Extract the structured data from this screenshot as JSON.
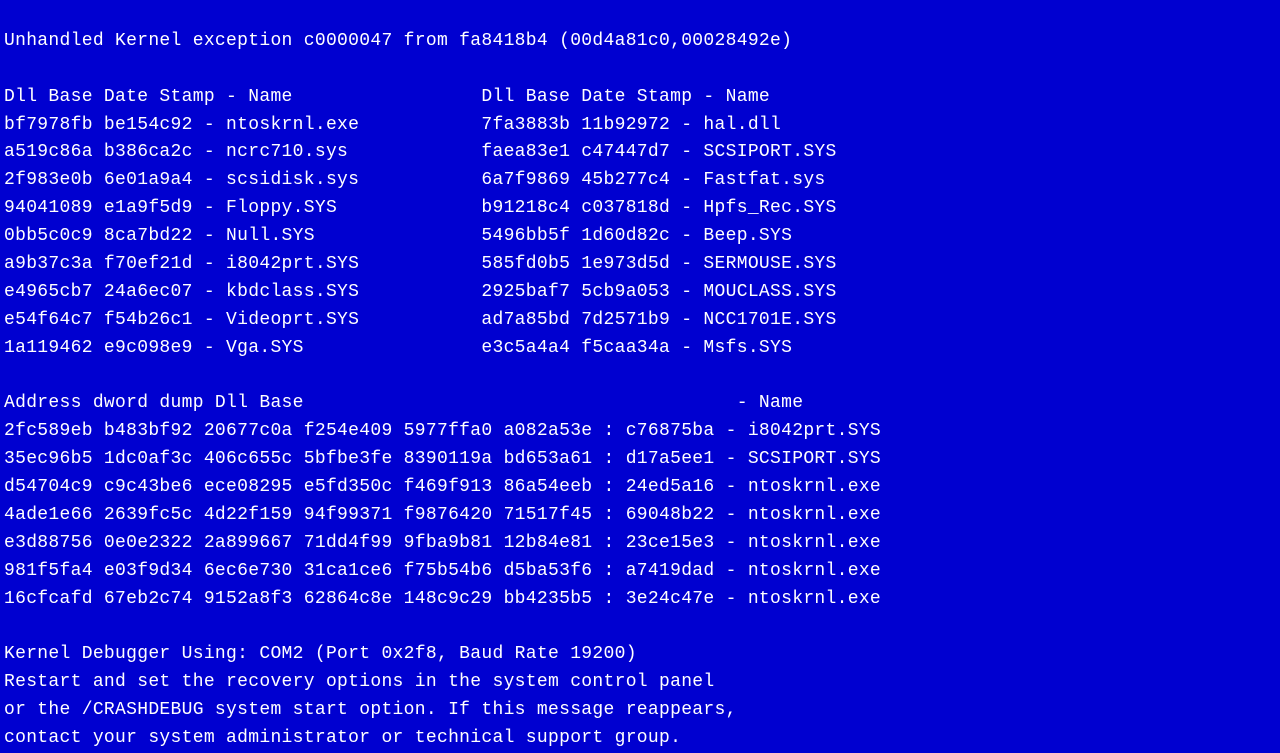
{
  "header_line": "Unhandled Kernel exception c0000047 from fa8418b4 (00d4a81c0,00028492e)",
  "dll_header_left": "Dll Base Date Stamp - Name",
  "dll_header_right": "Dll Base Date Stamp - Name",
  "modules": [
    {
      "lbase": "bf7978fb",
      "lstamp": "be154c92",
      "lname": "ntoskrnl.exe",
      "rbase": "7fa3883b",
      "rstamp": "11b92972",
      "rname": "hal.dll"
    },
    {
      "lbase": "a519c86a",
      "lstamp": "b386ca2c",
      "lname": "ncrc710.sys",
      "rbase": "faea83e1",
      "rstamp": "c47447d7",
      "rname": "SCSIPORT.SYS"
    },
    {
      "lbase": "2f983e0b",
      "lstamp": "6e01a9a4",
      "lname": "scsidisk.sys",
      "rbase": "6a7f9869",
      "rstamp": "45b277c4",
      "rname": "Fastfat.sys"
    },
    {
      "lbase": "94041089",
      "lstamp": "e1a9f5d9",
      "lname": "Floppy.SYS",
      "rbase": "b91218c4",
      "rstamp": "c037818d",
      "rname": "Hpfs_Rec.SYS"
    },
    {
      "lbase": "0bb5c0c9",
      "lstamp": "8ca7bd22",
      "lname": "Null.SYS",
      "rbase": "5496bb5f",
      "rstamp": "1d60d82c",
      "rname": "Beep.SYS"
    },
    {
      "lbase": "a9b37c3a",
      "lstamp": "f70ef21d",
      "lname": "i8042prt.SYS",
      "rbase": "585fd0b5",
      "rstamp": "1e973d5d",
      "rname": "SERMOUSE.SYS"
    },
    {
      "lbase": "e4965cb7",
      "lstamp": "24a6ec07",
      "lname": "kbdclass.SYS",
      "rbase": "2925baf7",
      "rstamp": "5cb9a053",
      "rname": "MOUCLASS.SYS"
    },
    {
      "lbase": "e54f64c7",
      "lstamp": "f54b26c1",
      "lname": "Videoprt.SYS",
      "rbase": "ad7a85bd",
      "rstamp": "7d2571b9",
      "rname": "NCC1701E.SYS"
    },
    {
      "lbase": "1a119462",
      "lstamp": "e9c098e9",
      "lname": "Vga.SYS",
      "rbase": "e3c5a4a4",
      "rstamp": "f5caa34a",
      "rname": "Msfs.SYS"
    }
  ],
  "dump_header_left": "Address dword dump Dll Base",
  "dump_header_right": "- Name",
  "dump": [
    {
      "a": "2fc589eb",
      "d1": "b483bf92",
      "d2": "20677c0a",
      "d3": "f254e409",
      "d4": "5977ffa0",
      "d5": "a082a53e",
      "base": "c76875ba",
      "name": "i8042prt.SYS"
    },
    {
      "a": "35ec96b5",
      "d1": "1dc0af3c",
      "d2": "406c655c",
      "d3": "5bfbe3fe",
      "d4": "8390119a",
      "d5": "bd653a61",
      "base": "d17a5ee1",
      "name": "SCSIPORT.SYS"
    },
    {
      "a": "d54704c9",
      "d1": "c9c43be6",
      "d2": "ece08295",
      "d3": "e5fd350c",
      "d4": "f469f913",
      "d5": "86a54eeb",
      "base": "24ed5a16",
      "name": "ntoskrnl.exe"
    },
    {
      "a": "4ade1e66",
      "d1": "2639fc5c",
      "d2": "4d22f159",
      "d3": "94f99371",
      "d4": "f9876420",
      "d5": "71517f45",
      "base": "69048b22",
      "name": "ntoskrnl.exe"
    },
    {
      "a": "e3d88756",
      "d1": "0e0e2322",
      "d2": "2a899667",
      "d3": "71dd4f99",
      "d4": "9fba9b81",
      "d5": "12b84e81",
      "base": "23ce15e3",
      "name": "ntoskrnl.exe"
    },
    {
      "a": "981f5fa4",
      "d1": "e03f9d34",
      "d2": "6ec6e730",
      "d3": "31ca1ce6",
      "d4": "f75b54b6",
      "d5": "d5ba53f6",
      "base": "a7419dad",
      "name": "ntoskrnl.exe"
    },
    {
      "a": "16cfcafd",
      "d1": "67eb2c74",
      "d2": "9152a8f3",
      "d3": "62864c8e",
      "d4": "148c9c29",
      "d5": "bb4235b5",
      "base": "3e24c47e",
      "name": "ntoskrnl.exe"
    }
  ],
  "footer": [
    "Kernel Debugger Using: COM2 (Port 0x2f8, Baud Rate 19200)",
    "Restart and set the recovery options in the system control panel",
    "or the /CRASHDEBUG system start option. If this message reappears,",
    "contact your system administrator or technical support group."
  ]
}
